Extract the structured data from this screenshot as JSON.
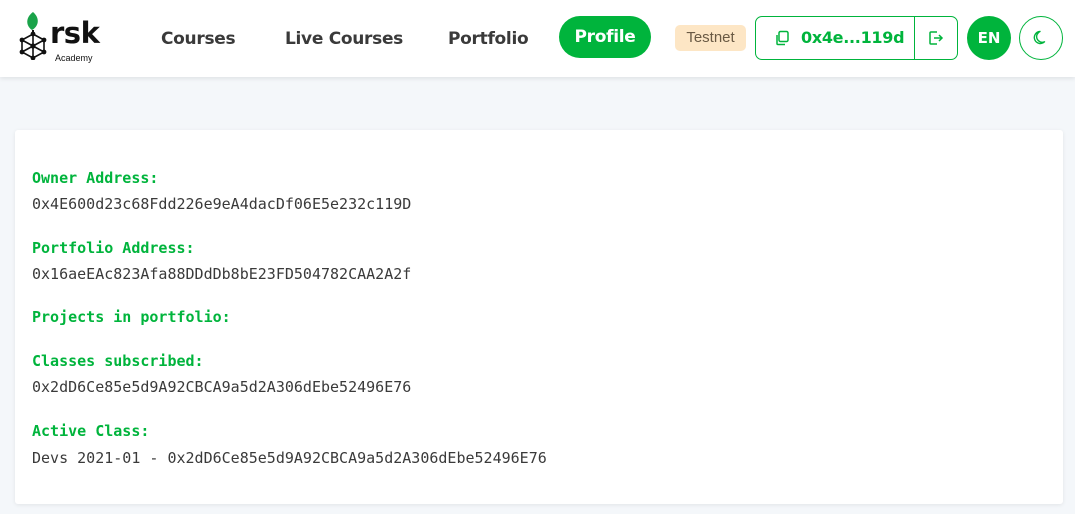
{
  "brand": {
    "name": "rsk",
    "sub": "Academy"
  },
  "nav": {
    "courses": "Courses",
    "live_courses": "Live Courses",
    "portfolio": "Portfolio",
    "profile": "Profile"
  },
  "network_badge": "Testnet",
  "wallet": {
    "short_address": "0x4e...119d"
  },
  "language": "EN",
  "colors": {
    "accent": "#00b43c",
    "badge_bg": "#fde6c5",
    "page_bg": "#f4f7fa"
  },
  "icons": {
    "copy": "copy-icon",
    "logout": "logout-icon",
    "theme": "moon-icon"
  },
  "profile": {
    "owner_label": "Owner Address:",
    "owner_value": "0x4E600d23c68Fdd226e9eA4dacDf06E5e232c119D",
    "portfolio_label": "Portfolio Address:",
    "portfolio_value": "0x16aeEAc823Afa88DDdDb8bE23FD504782CAA2A2f",
    "projects_label": "Projects in portfolio:",
    "classes_label": "Classes subscribed:",
    "classes_value": "0x2dD6Ce85e5d9A92CBCA9a5d2A306dEbe52496E76",
    "active_label": "Active Class:",
    "active_value": "Devs 2021-01 - 0x2dD6Ce85e5d9A92CBCA9a5d2A306dEbe52496E76"
  }
}
